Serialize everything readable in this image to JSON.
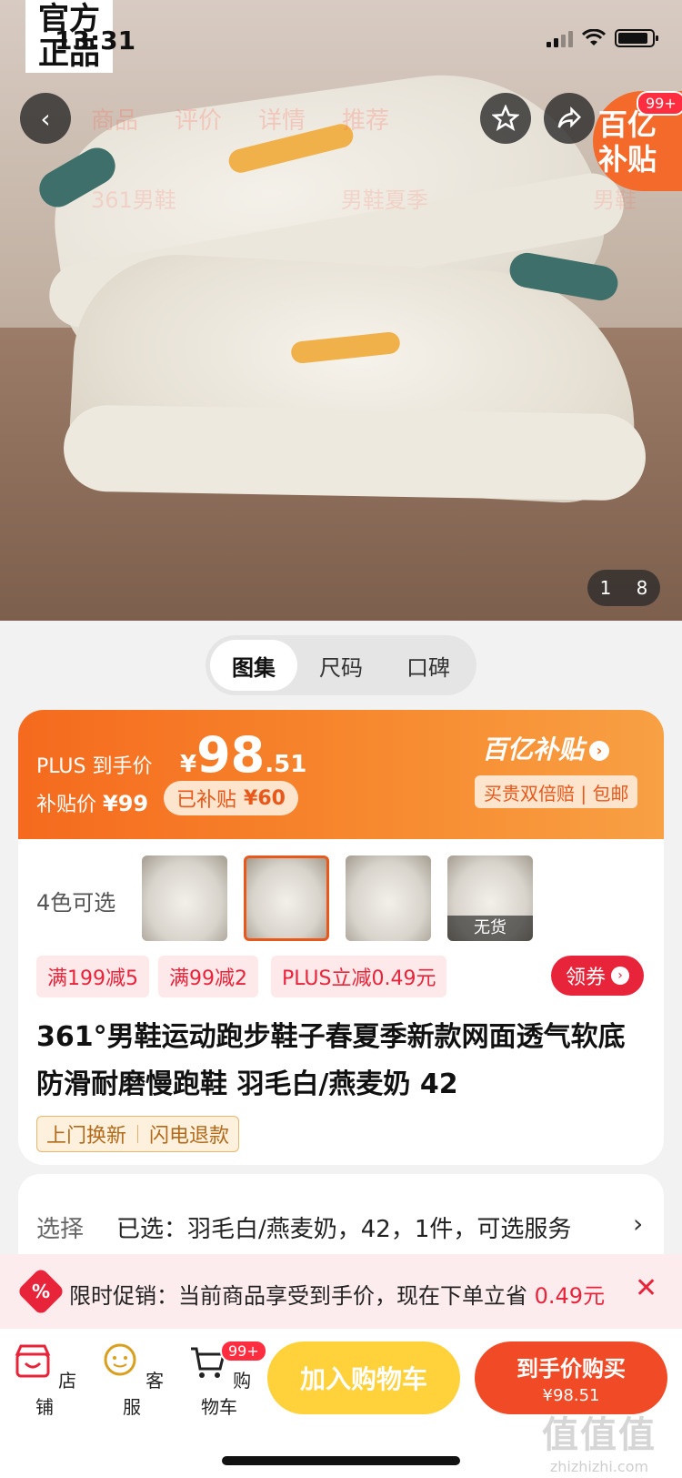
{
  "status": {
    "time": "13:31"
  },
  "hero": {
    "official_badge": "官方\n正品",
    "faded_tabs": [
      "商品",
      "评价",
      "详情",
      "推荐"
    ],
    "faded_categories": [
      "361男鞋",
      "男鞋夏季",
      "男鞋"
    ],
    "subsidy_badge": "百亿\n补贴",
    "badge_count": "99+",
    "page_current": "1",
    "page_total": "8"
  },
  "tabs": [
    {
      "label": "图集",
      "active": true
    },
    {
      "label": "尺码",
      "active": false
    },
    {
      "label": "口碑",
      "active": false
    }
  ],
  "price": {
    "plus_label": "PLUS 到手价",
    "currency": "¥",
    "integer": "98",
    "decimal": ".51",
    "subsidy_label": "补贴价",
    "subsidy_price": "¥99",
    "already_label": "已补贴",
    "already_amount": "¥60",
    "program_name": "百亿补贴",
    "program_tag": "买贵双倍赔 | 包邮"
  },
  "variants": {
    "label": "4色可选",
    "items": [
      {
        "name": "variant-1",
        "selected": false,
        "out_of_stock": ""
      },
      {
        "name": "variant-2",
        "selected": true,
        "out_of_stock": ""
      },
      {
        "name": "variant-3",
        "selected": false,
        "out_of_stock": ""
      },
      {
        "name": "variant-4",
        "selected": false,
        "out_of_stock": "无货"
      }
    ]
  },
  "coupons": [
    "满199减5",
    "满99减2",
    "PLUS立减0.49元"
  ],
  "get_coupon": "领券",
  "product_title": "361°男鞋运动跑步鞋子春夏季新款网面透气软底防滑耐磨慢跑鞋 羽毛白/燕麦奶 42",
  "services": [
    "上门换新",
    "闪电退款"
  ],
  "selection": {
    "label": "选择",
    "value": "已选：羽毛白/燕麦奶，42，1件，可选服务",
    "chevron": "›"
  },
  "promo": {
    "icon": "%",
    "text": "限时促销：当前商品享受到手价，现在下单立省",
    "amount": "0.49元",
    "close": "✕"
  },
  "bottom_nav": {
    "store": "店铺",
    "service": "客服",
    "cart": "购物车",
    "cart_badge": "99+",
    "add_to_cart": "加入购物车",
    "buy_label": "到手价购买",
    "buy_price": "¥98.51"
  },
  "watermark": {
    "title": "值值值",
    "url": "zhizhizhi.com"
  },
  "colors": {
    "accent": "#f56a1e",
    "red": "#e8243a",
    "yellow": "#ffd13a"
  }
}
